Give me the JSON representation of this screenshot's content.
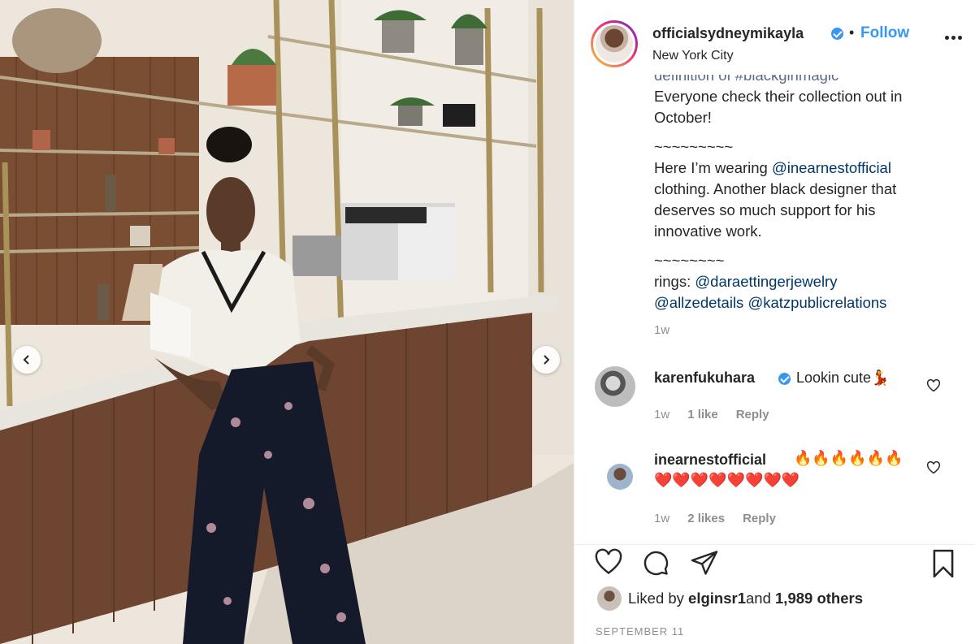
{
  "post": {
    "username": "officialsydneymikayla",
    "follow_label": "Follow",
    "dot": "•",
    "location": "New York City",
    "caption": {
      "cut_line": "definition of #blackgirlmagic",
      "line1": "Everyone check their collection out in October!",
      "tilde1": "~~~~~~~~~",
      "line2_pre": "Here I’m wearing ",
      "line2_tag": "@inearnestofficial",
      "line2_post": " clothing. Another black designer that deserves so much support for his innovative work.",
      "tilde2": "~~~~~~~~",
      "rings_pre": "rings: ",
      "tag1": "@daraettingerjewelry",
      "tag2": "@allzedetails",
      "tag3": "@katzpublicrelations",
      "time": "1w"
    },
    "comments": [
      {
        "username": "karenfukuhara",
        "text": "Lookin cute💃",
        "time": "1w",
        "likes": "1 like",
        "reply": "Reply"
      },
      {
        "username": "inearnestofficial",
        "text_line1": "🔥🔥🔥🔥🔥🔥",
        "text_line2": "❤️❤️❤️❤️❤️❤️❤️❤️",
        "time": "1w",
        "likes": "2 likes",
        "reply": "Reply"
      }
    ],
    "liked_by": {
      "prefix": "Liked by ",
      "user": "elginsr1",
      "and": " and ",
      "others": "1,989 others"
    },
    "date": "SEPTEMBER 11"
  },
  "icons": {
    "verified": "verified-badge-icon",
    "more": "more-options-icon",
    "prev": "chevron-left-icon",
    "next": "chevron-right-icon",
    "like": "heart-outline-icon",
    "comment": "comment-bubble-icon",
    "share": "paper-plane-icon",
    "save": "bookmark-icon"
  },
  "colors": {
    "accent": "#3897f0",
    "mention": "#00376b",
    "muted": "#8e8e8e",
    "text": "#262626"
  }
}
